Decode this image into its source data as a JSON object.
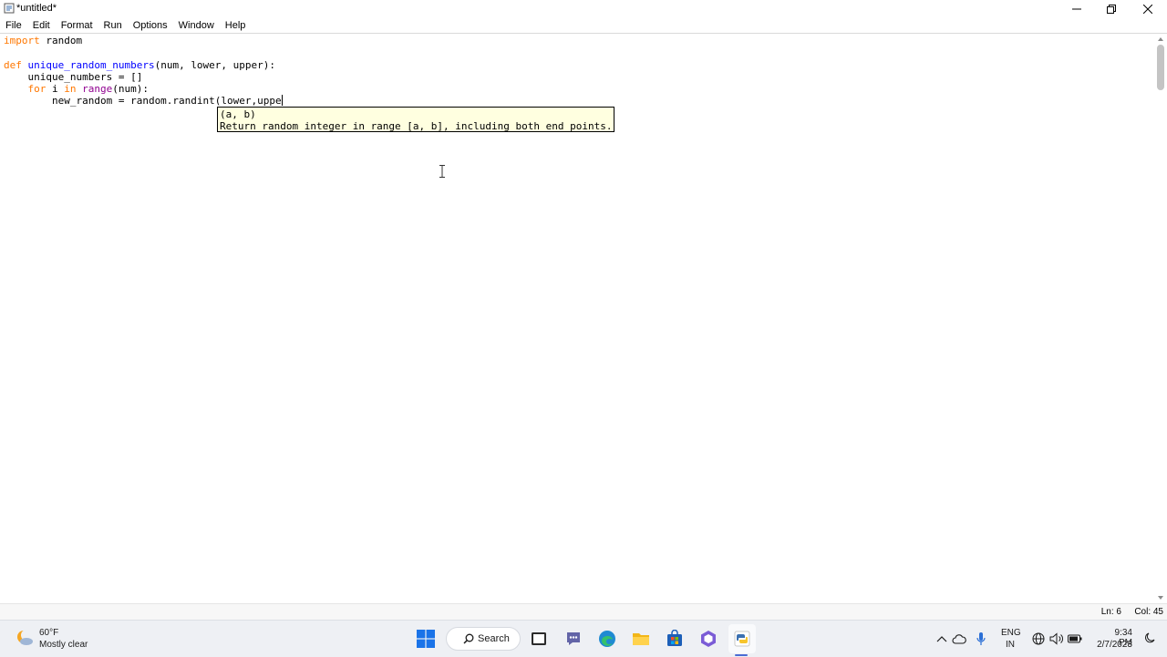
{
  "window": {
    "title": "*untitled*",
    "menu": [
      "File",
      "Edit",
      "Format",
      "Run",
      "Options",
      "Window",
      "Help"
    ]
  },
  "editor": {
    "lines": [
      [
        {
          "t": "import",
          "c": "kw"
        },
        {
          "t": " random"
        }
      ],
      [],
      [
        {
          "t": "def",
          "c": "kw"
        },
        {
          "t": " "
        },
        {
          "t": "unique_random_numbers",
          "c": "fn"
        },
        {
          "t": "(num, lower, upper):"
        }
      ],
      [
        {
          "t": "    unique_numbers = []"
        }
      ],
      [
        {
          "t": "    "
        },
        {
          "t": "for",
          "c": "kw"
        },
        {
          "t": " i "
        },
        {
          "t": "in",
          "c": "kw"
        },
        {
          "t": " "
        },
        {
          "t": "range",
          "c": "bi"
        },
        {
          "t": "(num):"
        }
      ],
      [
        {
          "t": "        new_random = random.randint(lower,uppe"
        }
      ]
    ],
    "calltip": {
      "signature": "(a, b)",
      "doc": "Return random integer in range [a, b], including both end points."
    }
  },
  "status": {
    "line": "Ln: 6",
    "col": "Col: 45"
  },
  "taskbar": {
    "weather_temp": "60°F",
    "weather_desc": "Mostly clear",
    "search_label": "Search",
    "lang_top": "ENG",
    "lang_bottom": "IN",
    "time": "9:34 PM",
    "date": "2/7/2023",
    "colors": {
      "accent": "#4a6cd4",
      "calltip_bg": "#ffffe0",
      "keyword": "#ff7700",
      "builtin": "#900090",
      "def_name": "#0000ff"
    }
  }
}
